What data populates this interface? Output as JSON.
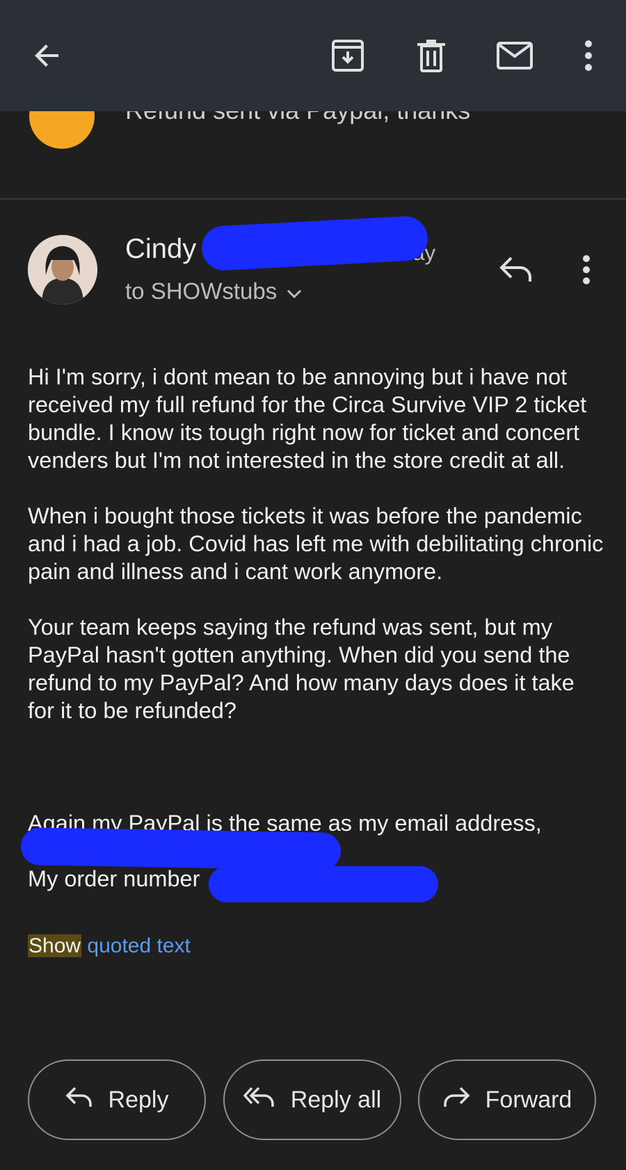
{
  "toolbar": {
    "icons": [
      "back-arrow-icon",
      "archive-icon",
      "delete-icon",
      "mark-unread-icon",
      "more-vert-icon"
    ]
  },
  "previous_message": {
    "snippet": "Refund sent via Paypal, thanks"
  },
  "message": {
    "sender_name": "Cindy",
    "time_visible": "terday",
    "recipient": "to SHOWstubs",
    "paragraphs": [
      "Hi I'm sorry, i dont mean to be annoying but i have not received my full refund for the Circa Survive VIP 2 ticket bundle. I know its tough right now for ticket and concert venders but I'm not interested in the store credit at all.",
      "When i bought those tickets it was before the pandemic and i had a job. Covid has left me with debilitating chronic pain and illness and i cant work anymore.",
      "Your team keeps saying the refund was sent, but my PayPal hasn't gotten anything. When did you send the refund to my PayPal? And how many days does it take for it to be refunded?"
    ],
    "line_paypal": "Again my PayPal is the same as my email address,",
    "line_order": "My order number",
    "show_label": "Show",
    "quoted_label": "quoted text"
  },
  "actions": {
    "reply": "Reply",
    "reply_all": "Reply all",
    "forward": "Forward"
  },
  "colors": {
    "background": "#1f1f1f",
    "toolbar": "#2b2f36",
    "accent_link": "#5b9cf0",
    "redaction": "#1a2bff",
    "prev_avatar": "#f5a623"
  }
}
